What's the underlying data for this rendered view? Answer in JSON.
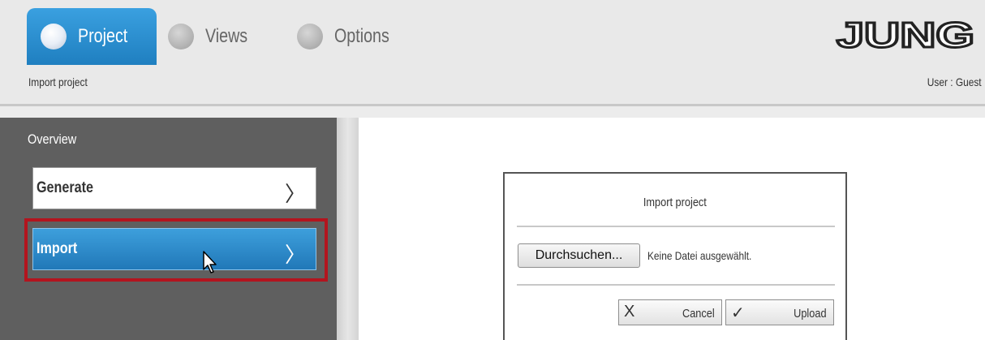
{
  "header": {
    "tabs": [
      {
        "label": "Project",
        "active": true
      },
      {
        "label": "Views",
        "active": false
      },
      {
        "label": "Options",
        "active": false
      }
    ],
    "logo_text": "JUNG",
    "breadcrumb": "Import project",
    "user": "User : Guest"
  },
  "sidebar": {
    "title": "Overview",
    "items": [
      {
        "label": "Generate",
        "chevron": "〉",
        "selected": false
      },
      {
        "label": "Import",
        "chevron": "〉",
        "selected": true
      }
    ]
  },
  "dialog": {
    "title": "Import project",
    "browse_label": "Durchsuchen...",
    "file_status": "Keine Datei ausgewählt.",
    "cancel_icon": "X",
    "cancel_label": "Cancel",
    "upload_icon": "✓",
    "upload_label": "Upload"
  },
  "colors": {
    "accent": "#2a8ccd",
    "highlight_frame": "#b3141e",
    "sidebar_bg": "#5f5f5f"
  }
}
